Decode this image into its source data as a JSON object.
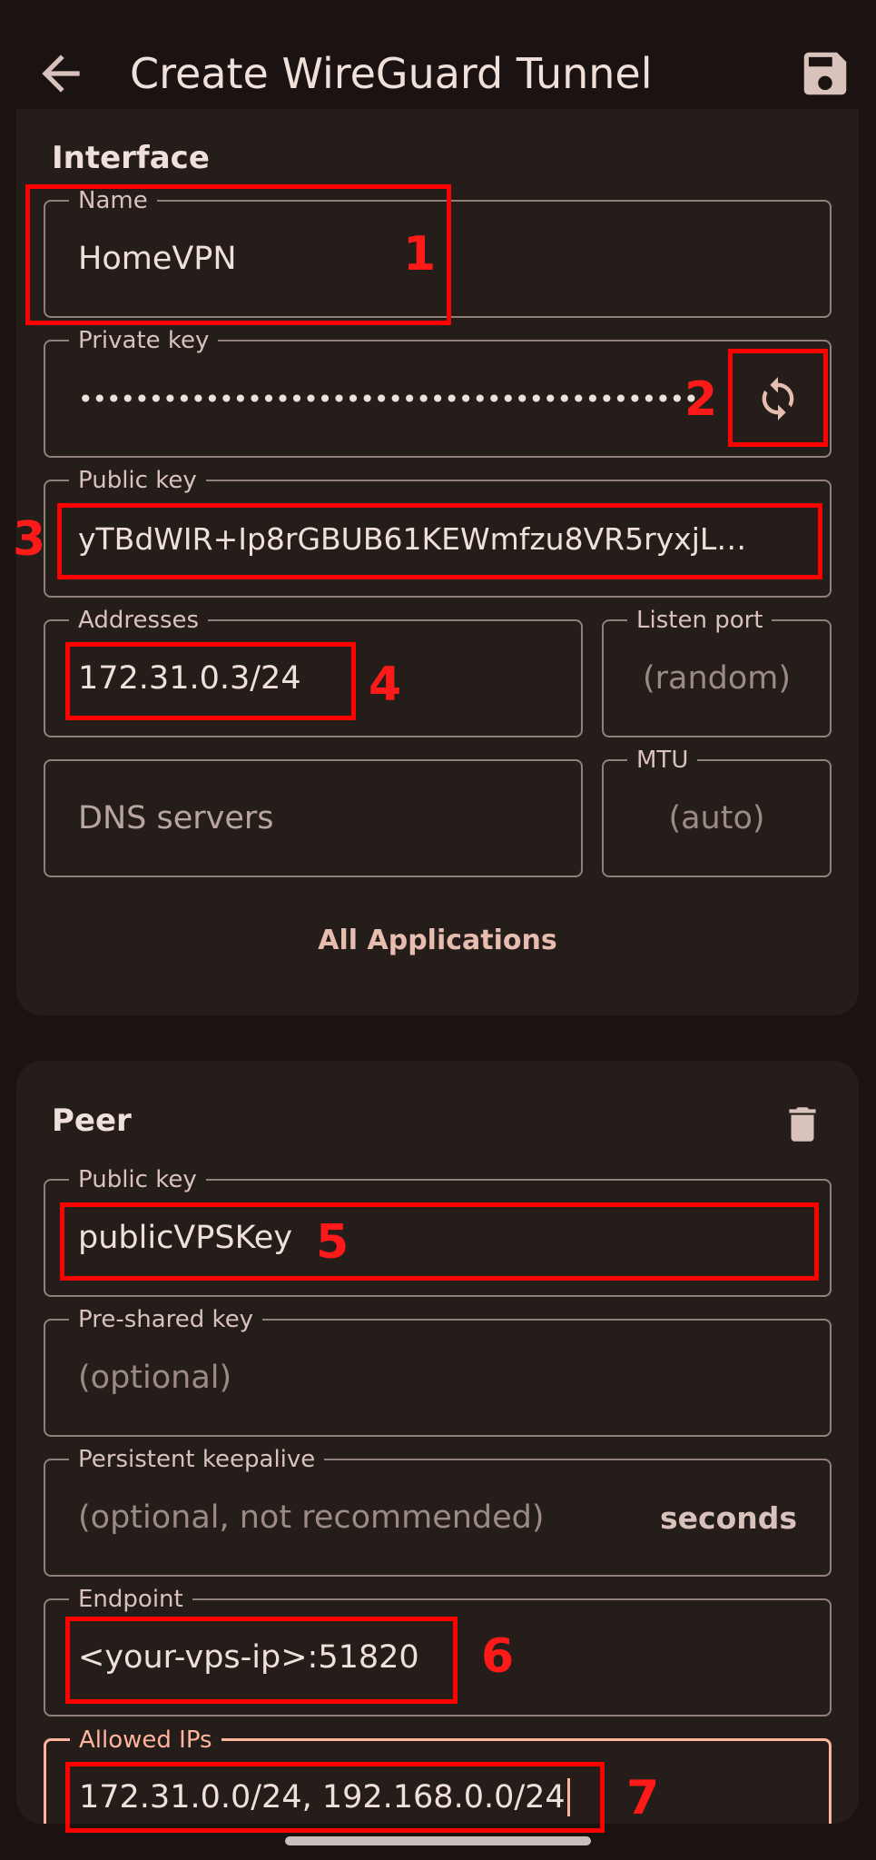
{
  "appbar": {
    "title": "Create WireGuard Tunnel",
    "back_icon": "arrow-left-icon",
    "save_icon": "floppy-save-icon"
  },
  "interface": {
    "section_title": "Interface",
    "name": {
      "label": "Name",
      "value": "HomeVPN"
    },
    "private_key": {
      "label": "Private key",
      "value": "••••••••••••••••••••••••••••••••••••••••••••",
      "action_icon": "refresh-icon"
    },
    "public_key": {
      "label": "Public key",
      "value": "yTBdWIR+Ip8rGBUB61KEWmfzu8VR5ryxjL…"
    },
    "addresses": {
      "label": "Addresses",
      "value": "172.31.0.3/24"
    },
    "listen_port": {
      "label": "Listen port",
      "placeholder": "(random)"
    },
    "dns_servers": {
      "placeholder": "DNS servers"
    },
    "mtu": {
      "label": "MTU",
      "placeholder": "(auto)"
    },
    "applications_button": "All Applications"
  },
  "peer": {
    "section_title": "Peer",
    "delete_icon": "trash-icon",
    "public_key": {
      "label": "Public key",
      "value": "publicVPSKey"
    },
    "preshared_key": {
      "label": "Pre-shared key",
      "placeholder": "(optional)"
    },
    "keepalive": {
      "label": "Persistent keepalive",
      "placeholder": "(optional, not recommended)",
      "suffix": "seconds"
    },
    "endpoint": {
      "label": "Endpoint",
      "value": "<your-vps-ip>:51820"
    },
    "allowed_ips": {
      "label": "Allowed IPs",
      "value": "172.31.0.0/24, 192.168.0.0/24"
    }
  },
  "annotations": [
    "1",
    "2",
    "3",
    "4",
    "5",
    "6",
    "7"
  ],
  "colors": {
    "background": "#1a1311",
    "card": "#251d1a",
    "accent": "#ffb59d",
    "annotation": "#ff0000"
  }
}
